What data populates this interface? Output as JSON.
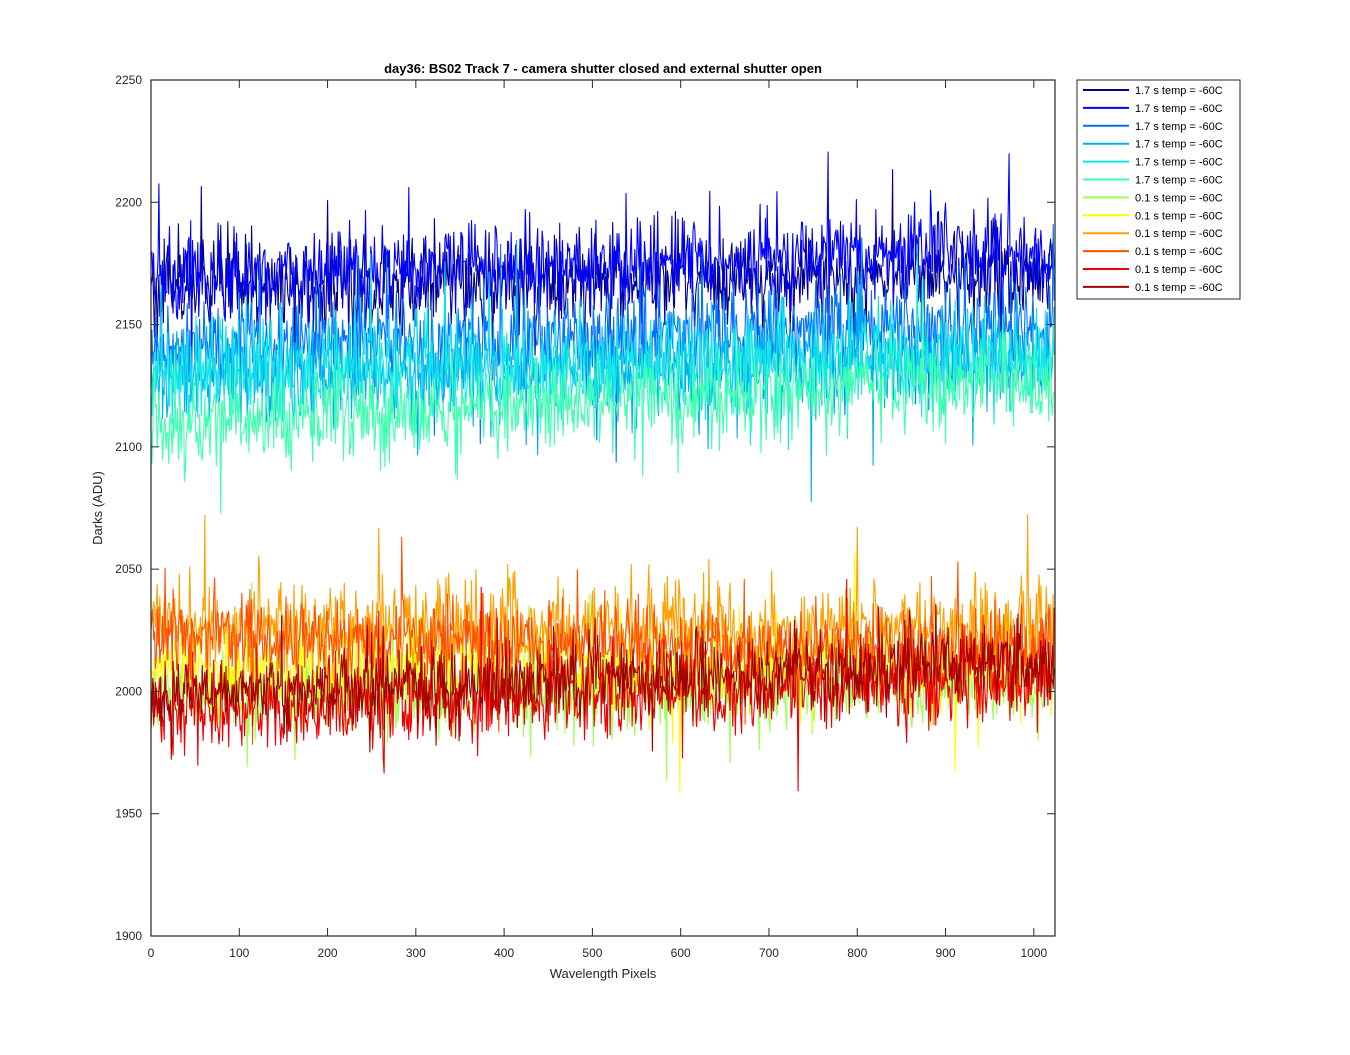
{
  "chart_data": {
    "type": "line",
    "title": "day36: BS02  Track 7 - camera shutter closed and external shutter open",
    "xlabel": "Wavelength Pixels",
    "ylabel": "Darks (ADU)",
    "xlim": [
      0,
      1024
    ],
    "ylim": [
      1900,
      2250
    ],
    "xticks": [
      0,
      100,
      200,
      300,
      400,
      500,
      600,
      700,
      800,
      900,
      1000
    ],
    "yticks": [
      1900,
      1950,
      2000,
      2050,
      2100,
      2150,
      2200,
      2250
    ],
    "grid": false,
    "legend_position": "outside-top-right",
    "num_points": 1024,
    "series": [
      {
        "name": "1.7 s temp = -60C",
        "color": "#00008f",
        "mean_start": 2164,
        "mean_end": 2172,
        "spread": 9
      },
      {
        "name": "1.7 s temp = -60C",
        "color": "#0000ff",
        "mean_start": 2170,
        "mean_end": 2180,
        "spread": 9
      },
      {
        "name": "1.7 s temp = -60C",
        "color": "#0070ff",
        "mean_start": 2140,
        "mean_end": 2150,
        "spread": 10
      },
      {
        "name": "1.7 s temp = -60C",
        "color": "#00b0ee",
        "mean_start": 2128,
        "mean_end": 2135,
        "spread": 10
      },
      {
        "name": "1.7 s temp = -60C",
        "color": "#10e8e8",
        "mean_start": 2132,
        "mean_end": 2138,
        "spread": 10
      },
      {
        "name": "1.7 s temp = -60C",
        "color": "#40ffb0",
        "mean_start": 2110,
        "mean_end": 2128,
        "spread": 9
      },
      {
        "name": "0.1 s temp = -60C",
        "color": "#a0ff50",
        "mean_start": 1998,
        "mean_end": 2003,
        "spread": 8
      },
      {
        "name": "0.1 s temp = -60C",
        "color": "#ffff00",
        "mean_start": 2008,
        "mean_end": 2012,
        "spread": 8
      },
      {
        "name": "0.1 s temp = -60C",
        "color": "#ffa000",
        "mean_start": 2026,
        "mean_end": 2026,
        "spread": 9
      },
      {
        "name": "0.1 s temp = -60C",
        "color": "#ff5000",
        "mean_start": 2024,
        "mean_end": 2016,
        "spread": 8
      },
      {
        "name": "0.1 s temp = -60C",
        "color": "#ee0000",
        "mean_start": 1992,
        "mean_end": 2006,
        "spread": 9
      },
      {
        "name": "0.1 s temp = -60C",
        "color": "#a00000",
        "mean_start": 1998,
        "mean_end": 2012,
        "spread": 8
      }
    ]
  }
}
